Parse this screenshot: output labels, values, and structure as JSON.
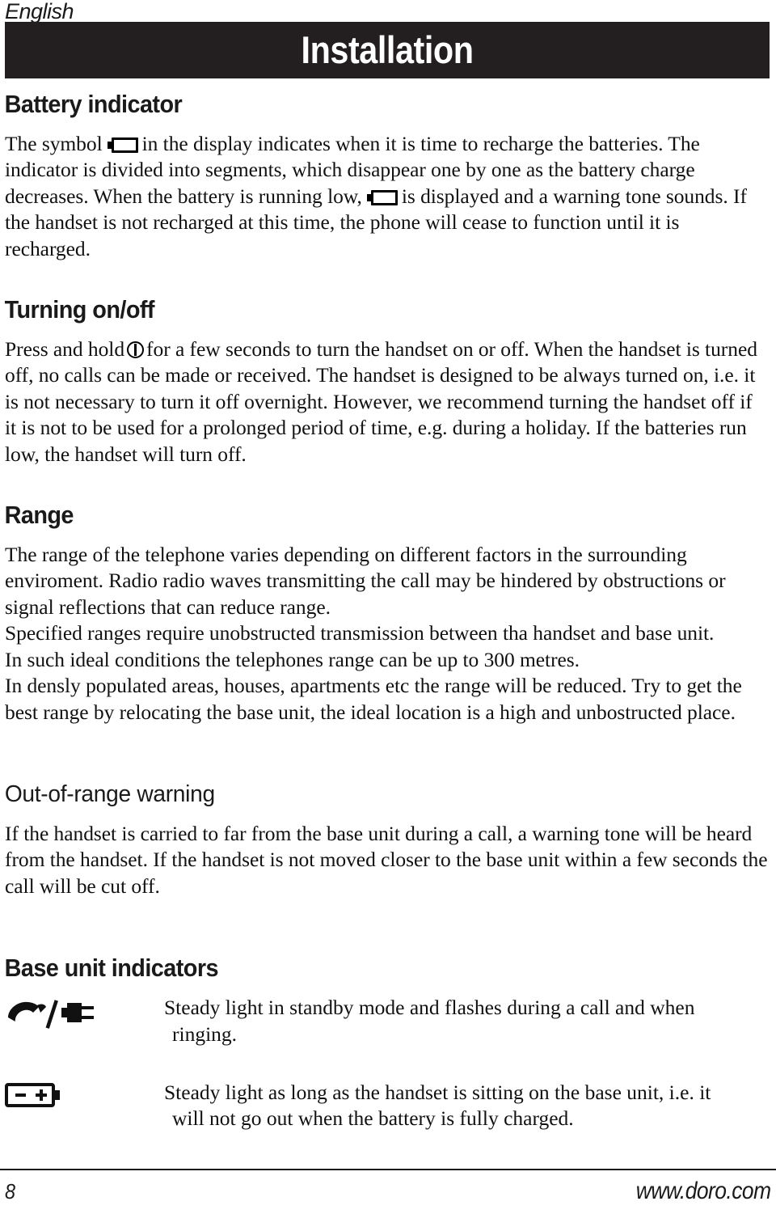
{
  "header": {
    "language_label": "English",
    "title": "Installation"
  },
  "sections": [
    {
      "id": "battery-indicator",
      "heading": "Battery indicator",
      "heading_style": "bold",
      "paragraph_parts": {
        "p1a": "The symbol",
        "icon1": "battery-empty-icon",
        "p1b": "in the display indicates when it is time to recharge the batteries. The indicator is divided into segments, which disappear one by one as the battery charge decreases. When the battery is running low,",
        "icon2": "battery-empty-icon",
        "p1c": "is displayed and a warning tone sounds. If the handset is not recharged at this time, the phone will cease to function until it is recharged."
      }
    },
    {
      "id": "turning-on-off",
      "heading": "Turning on/off",
      "heading_style": "bold",
      "paragraph_parts": {
        "p1a": "Press and hold",
        "icon1": "power-button-icon",
        "p1b": "for a few seconds to turn the handset on or off. When the handset is turned off, no calls can be made or received. The handset is designed to be always turned on, i.e. it is not necessary to turn it off overnight. However, we recommend turning the handset off if it is not to be used for a prolonged period of time, e.g. during a holiday. If the batteries run low, the handset will turn off."
      }
    },
    {
      "id": "range",
      "heading": "Range",
      "heading_style": "bold",
      "paragraphs": [
        "The range of the telephone varies depending on different factors in the surrounding enviroment. Radio radio waves transmitting the call may be hindered by obstructions or signal reflections that can reduce range.",
        "Specified ranges require unobstructed transmission between tha handset and base unit.",
        "In such ideal conditions the telephones range can be up to 300 metres.",
        "In densly populated areas, houses, apartments etc the range will be reduced. Try to get the best range by relocating the base unit, the ideal location is a high and unbostructed place."
      ]
    },
    {
      "id": "out-of-range-warning",
      "heading": "Out-of-range warning",
      "heading_style": "regular",
      "paragraphs": [
        "If the handset is carried to far from the base unit during a call, a warning tone will be heard from the handset. If the handset is not moved closer to the base unit within a few seconds the call will be cut off."
      ]
    },
    {
      "id": "base-unit-indicators",
      "heading": "Base unit indicators",
      "heading_style": "bold",
      "indicators": [
        {
          "icon": "phone-handset-slash-plug-icon",
          "line1": "Steady light in standby mode and flashes during a call and when",
          "line2": "ringing."
        },
        {
          "icon": "battery-minus-plus-icon",
          "line1": "Steady light as long as the handset is sitting on the base unit, i.e. it",
          "line2": "will not go out when the battery is fully charged."
        }
      ]
    }
  ],
  "footer": {
    "page_number": "8",
    "website": "www.doro.com"
  },
  "colors": {
    "title_bar_background": "#231f20",
    "title_text": "#ffffff",
    "body_text": "#111111",
    "page_background": "#ffffff"
  }
}
